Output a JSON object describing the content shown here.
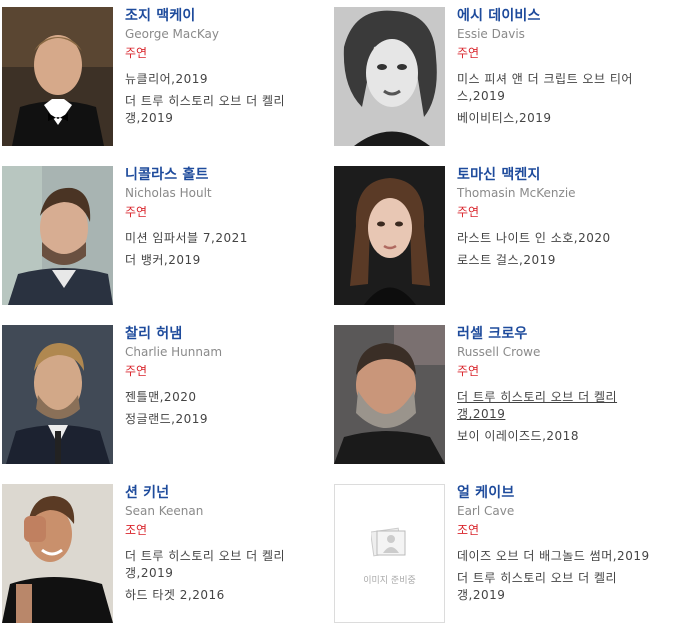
{
  "colors": {
    "name": "#1e4b9c",
    "role": "#d9262d",
    "english": "#8a8a8a",
    "film": "#444444"
  },
  "placeholder_text": "이미지 준비중",
  "actors": [
    {
      "kname": "조지 맥케이",
      "ename": "George MacKay",
      "role": "주연",
      "films": [
        "뉴클리어,2019",
        "더 트루 히스토리 오브 더 켈리 갱,2019"
      ]
    },
    {
      "kname": "에시 데이비스",
      "ename": "Essie Davis",
      "role": "주연",
      "films": [
        "미스 피셔 앤 더 크립트 오브 티어스,2019",
        "베이비티스,2019"
      ]
    },
    {
      "kname": "니콜라스 홀트",
      "ename": "Nicholas Hoult",
      "role": "주연",
      "films": [
        "미션 임파서블 7,2021",
        "더 뱅커,2019"
      ]
    },
    {
      "kname": "토마신 맥켄지",
      "ename": "Thomasin McKenzie",
      "role": "주연",
      "films": [
        "라스트 나이트 인 소호,2020",
        "로스트 걸스,2019"
      ]
    },
    {
      "kname": "찰리 허냄",
      "ename": "Charlie Hunnam",
      "role": "주연",
      "films": [
        "젠틀맨,2020",
        "정글랜드,2019"
      ]
    },
    {
      "kname": "러셀 크로우",
      "ename": "Russell Crowe",
      "role": "주연",
      "films": [
        "더 트루 히스토리 오브 더 켈리 갱,2019",
        "보이 이레이즈드,2018"
      ]
    },
    {
      "kname": "션 키넌",
      "ename": "Sean Keenan",
      "role": "조연",
      "films": [
        "더 트루 히스토리 오브 더 켈리 갱,2019",
        "하드 타겟 2,2016"
      ]
    },
    {
      "kname": "얼 케이브",
      "ename": "Earl Cave",
      "role": "조연",
      "films": [
        "데이즈 오브 더 배그놀드 썸머,2019",
        "더 트루 히스토리 오브 더 켈리 갱,2019"
      ]
    }
  ]
}
